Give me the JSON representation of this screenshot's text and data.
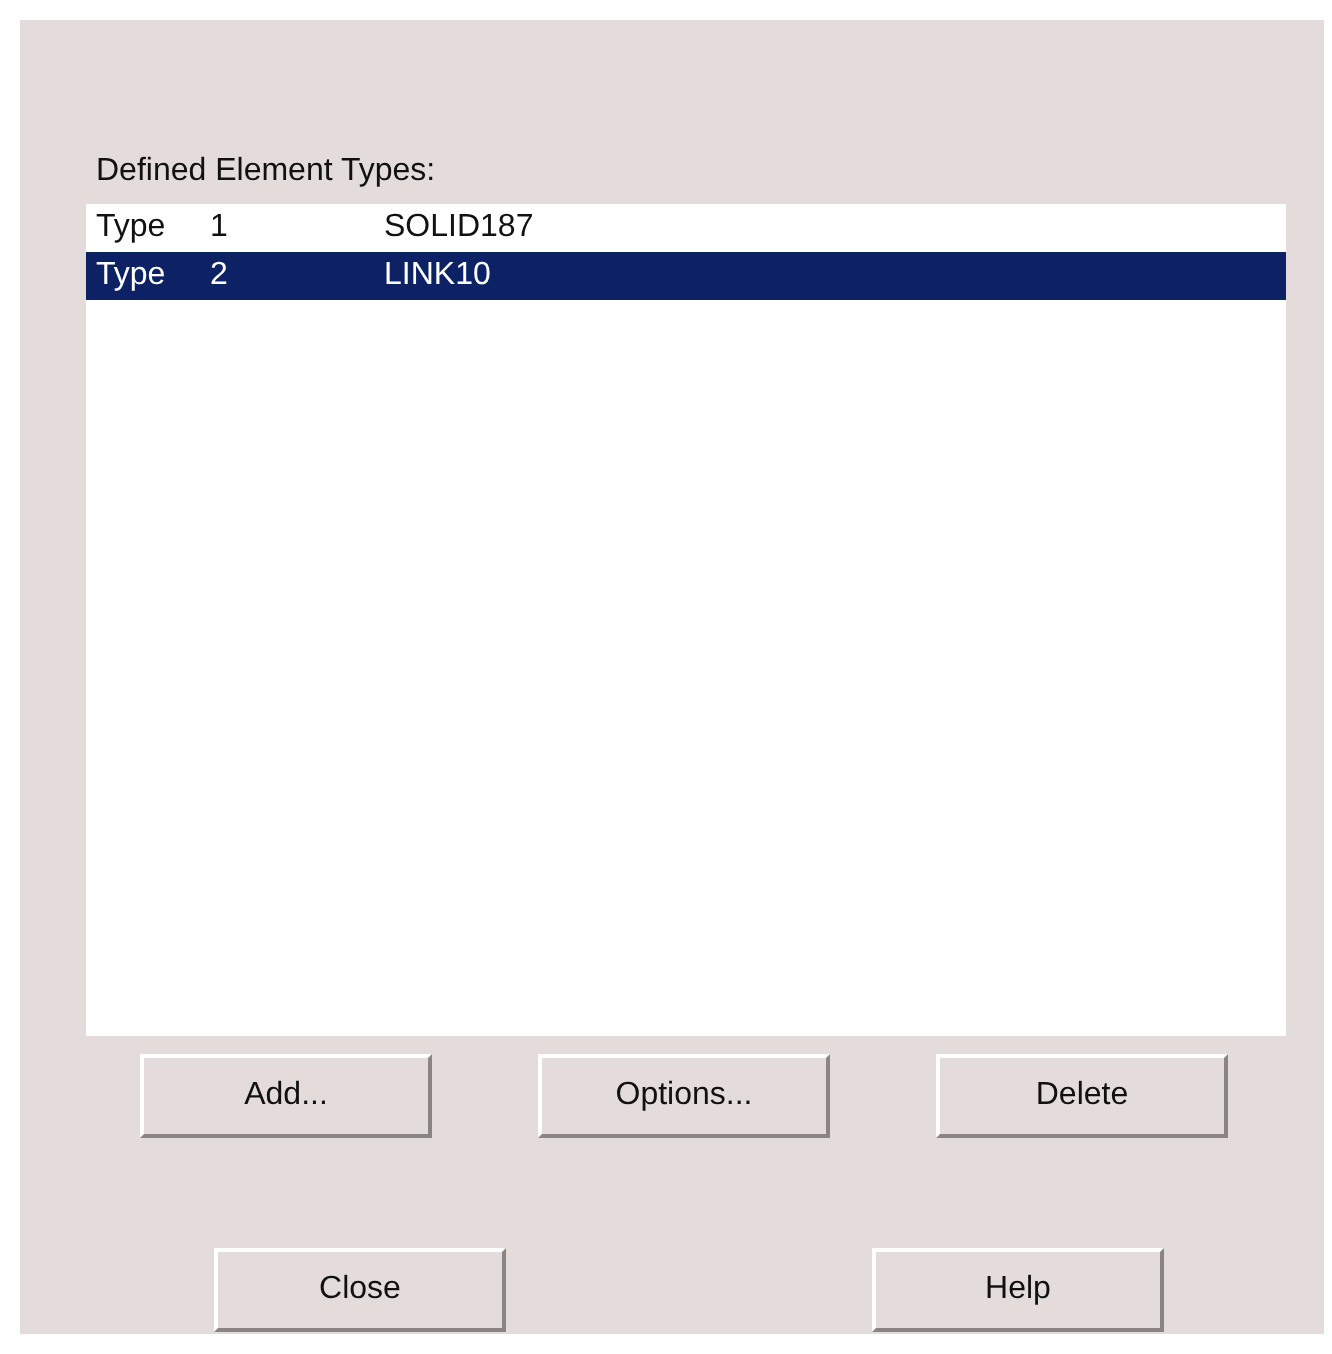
{
  "list_label": "Defined Element Types:",
  "element_types": [
    {
      "type": "Type",
      "number": "1",
      "name": "SOLID187",
      "selected": false
    },
    {
      "type": "Type",
      "number": "2",
      "name": "LINK10",
      "selected": true
    }
  ],
  "list_buttons": [
    "Add...",
    "Options...",
    "Delete"
  ],
  "dialog_buttons": [
    "Close",
    "Help"
  ]
}
